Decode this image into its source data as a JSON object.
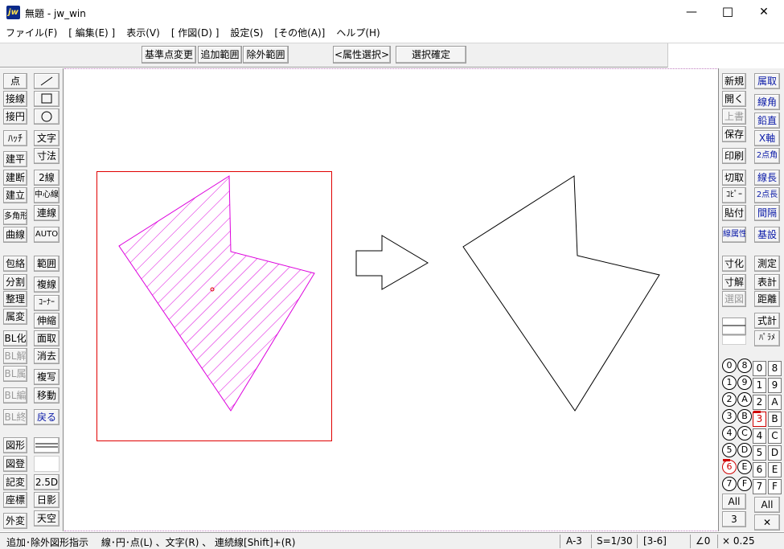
{
  "window": {
    "title": "無題 - jw_win",
    "app_icon": "jw",
    "minimize": "—",
    "maximize": "☐",
    "close": "✕"
  },
  "menu": [
    "ファイル(F)",
    "[ 編集(E) ]",
    "表示(V)",
    "[ 作図(D) ]",
    "設定(S)",
    "[その他(A)]",
    "ヘルプ(H)"
  ],
  "toolbar": {
    "base_point": "基準点変更",
    "add_range": "追加範囲",
    "exclude_range": "除外範囲",
    "attr_select": "<属性選択>",
    "confirm_select": "選択確定"
  },
  "left_tools": {
    "col1": [
      "点",
      "接線",
      "接円",
      "ﾊｯﾁ",
      "建平",
      "建断",
      "建立",
      "多角形",
      "曲線",
      "包絡",
      "分割",
      "整理",
      "属変",
      "BL化",
      "BL解",
      "BL属",
      "BL編",
      "BL終",
      "図形",
      "図登",
      "記変",
      "座標",
      "外変"
    ],
    "col2_top": [
      "文字",
      "寸法",
      "2線",
      "中心線",
      "連線",
      "AUTO",
      "範囲",
      "複線",
      "ｺｰﾅｰ",
      "伸縮",
      "面取",
      "消去",
      "複写",
      "移動",
      "戻る",
      "2.5D",
      "日影",
      "天空"
    ]
  },
  "right_tools": {
    "col1": [
      "新規",
      "開く",
      "上書",
      "保存",
      "印刷",
      "切取",
      "ｺﾋﾟｰ",
      "貼付",
      "線属性",
      "寸化",
      "寸解",
      "選図"
    ],
    "col2": [
      "属取",
      "線角",
      "鉛直",
      "X軸",
      "2点角",
      "線長",
      "2点長",
      "間隔",
      "基設",
      "測定",
      "表計",
      "距離",
      "式計",
      "ﾊﾟﾗﾒ"
    ],
    "group_layers": [
      "0",
      "1",
      "2",
      "3",
      "4",
      "5",
      "6",
      "7",
      "8",
      "9",
      "A",
      "B",
      "C",
      "D",
      "E",
      "F"
    ],
    "layers": [
      "0",
      "1",
      "2",
      "3",
      "4",
      "5",
      "6",
      "7",
      "8",
      "9",
      "A",
      "B",
      "C",
      "D",
      "E",
      "F"
    ],
    "all_label": "All",
    "group_current": "3",
    "close_x": "✕"
  },
  "status": {
    "prompt": "追加･除外図形指示　 線･円･点(L) 、文字(R) 、 連続線[Shift]+(R)",
    "paper": "A-3",
    "scale": "S=1/30",
    "layer": "[3-6]",
    "angle": "∠0",
    "factor": "× 0.25"
  },
  "colors": {
    "selection_frame": "#e00000",
    "selected_shape": "#dd00dd",
    "shape": "#000000"
  },
  "icons": [
    "line-tool-icon",
    "rectangle-tool-icon",
    "circle-tool-icon",
    "arrow-right-icon",
    "hatch-pattern"
  ]
}
